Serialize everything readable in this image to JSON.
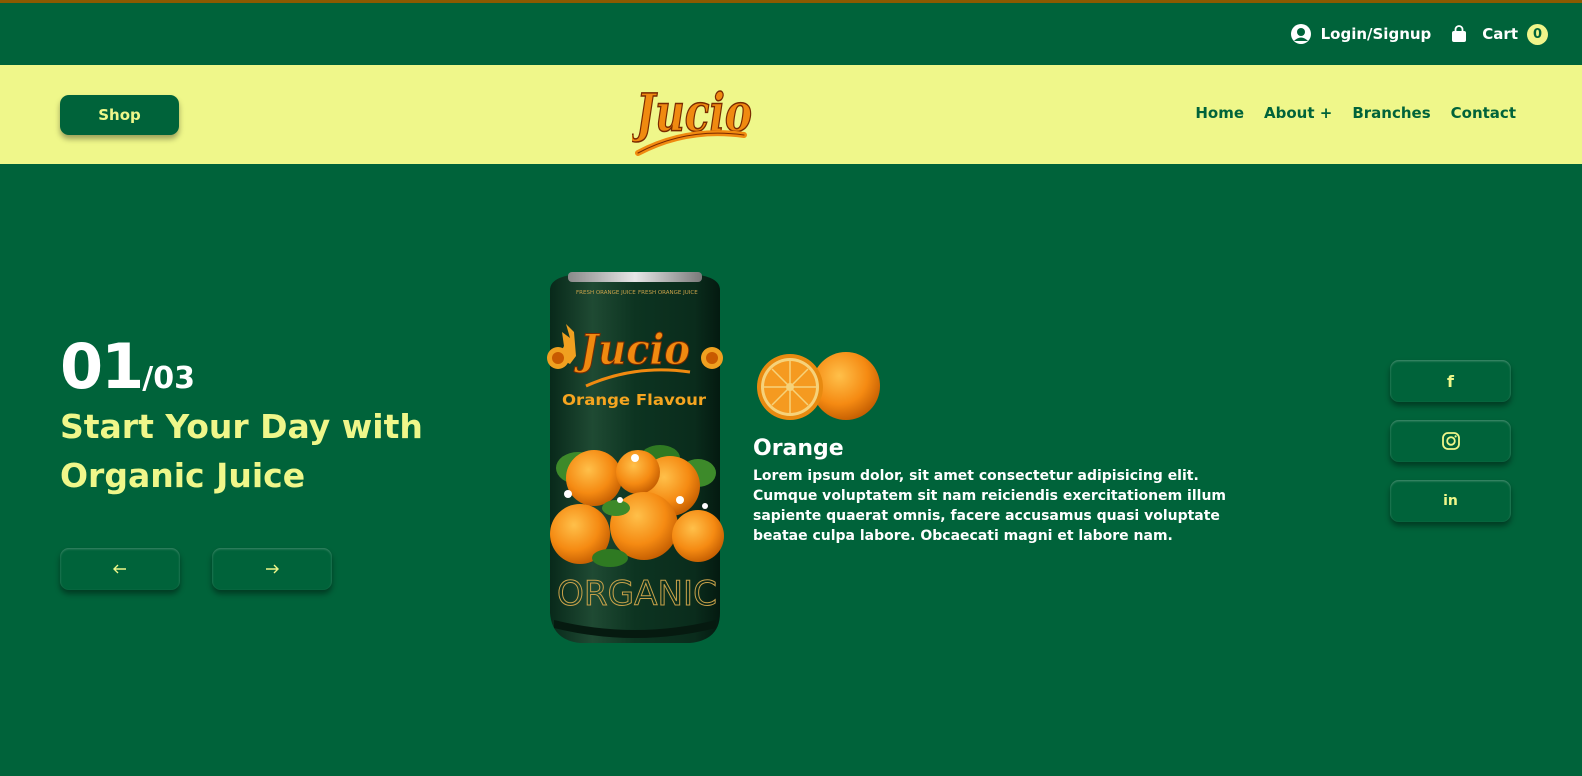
{
  "topbar": {
    "login_label": "Login/Signup",
    "cart_label": "Cart",
    "cart_count": "0"
  },
  "navbar": {
    "shop_label": "Shop",
    "logo_text": "Jucio",
    "menu": [
      "Home",
      "About +",
      "Branches",
      "Contact"
    ]
  },
  "hero": {
    "slide_current": "01",
    "slide_total": "/03",
    "headline": "Start Your Day with Organic Juice",
    "prev_icon": "arrow-left-icon",
    "next_icon": "arrow-right-icon"
  },
  "can": {
    "brand": "Jucio",
    "flavour": "Orange Flavour",
    "top_text": "FRESH ORANGE JUICE",
    "bottom_text": "ORGANIC"
  },
  "product": {
    "title": "Orange",
    "description": "Lorem ipsum dolor, sit amet consectetur adipisicing elit. Cumque voluptatem sit nam reiciendis exercitationem illum sapiente quaerat omnis, facere accusamus quasi voluptate beatae culpa labore. Obcaecati magni et labore nam."
  },
  "social": {
    "facebook": "f",
    "linkedin": "in"
  },
  "colors": {
    "background": "#00633a",
    "accent": "#eff78a",
    "orange": "#f08a10"
  }
}
